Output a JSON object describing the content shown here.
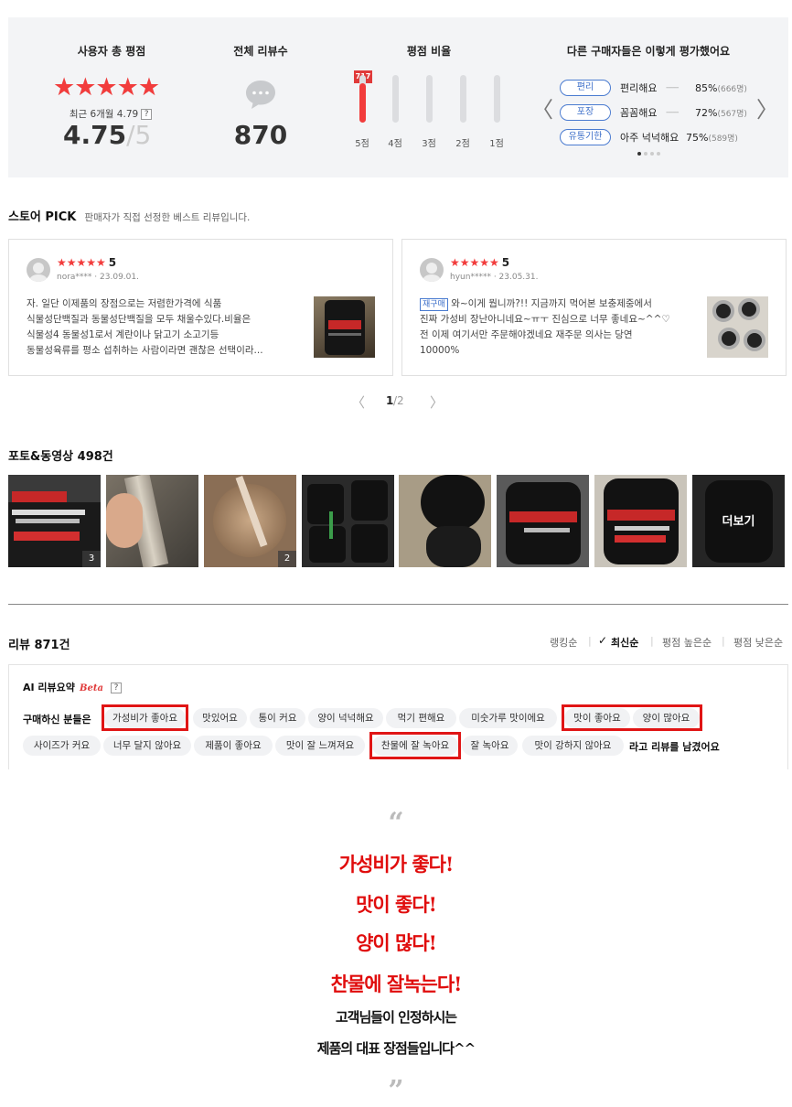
{
  "summary": {
    "rating_title": "사용자 총 평점",
    "recent_label": "최근 6개월 4.79",
    "help": "?",
    "rating": "4.75",
    "rating_max": "/5",
    "stars_value": 4.75,
    "total_title": "전체 리뷰수",
    "total_count": "870",
    "dist_title": "평점 비율",
    "dist": [
      {
        "label": "5점",
        "fraction": 0.82,
        "badge": "717"
      },
      {
        "label": "4점",
        "fraction": 0
      },
      {
        "label": "3점",
        "fraction": 0
      },
      {
        "label": "2점",
        "fraction": 0
      },
      {
        "label": "1점",
        "fraction": 0
      }
    ],
    "others_title": "다른 구매자들은 이렇게 평가했어요",
    "evaluations": [
      {
        "tag": "편리",
        "text": "편리해요",
        "dash": "------",
        "pct": "85%",
        "count": "(666명)"
      },
      {
        "tag": "포장",
        "text": "꼼꼼해요",
        "dash": "------",
        "pct": "72%",
        "count": "(567명)"
      },
      {
        "tag": "유통기한",
        "text": "아주 넉넉해요",
        "dash": "",
        "pct": "75%",
        "count": "(589명)"
      }
    ],
    "prev_arrow": "〈",
    "next_arrow": "〉"
  },
  "store_pick": {
    "title": "스토어 PICK",
    "subtitle": "판매자가 직접 선정한 베스트 리뷰입니다.",
    "cards": [
      {
        "stars": "★★★★★",
        "score": "5",
        "user": "nora****",
        "date": "23.09.01.",
        "lines": [
          "자. 일단 이제품의 장점으로는 저렴한가격에 식품",
          "식물성단백질과 동물성단백질을 모두 채울수있다.비율은",
          "식물성4 동물성1로서 계란이나 닭고기 소고기등",
          "동물성육류를 평소 섭취하는 사람이라면 괜찮은 선택이라..."
        ]
      },
      {
        "stars": "★★★★★",
        "score": "5",
        "user": "hyun*****",
        "date": "23.05.31.",
        "badge": "재구매",
        "lines": [
          "와~이게 뭡니까?!! 지금까지 먹어본 보충제중에서",
          "진짜 가성비 장난아니네요~ㅠㅜ 진심으로 너무 좋네요~^^♡",
          "전 이제 여기서만 주문해야겠네요 재주문 의사는 당연",
          "10000%"
        ]
      }
    ],
    "pager": {
      "current": "1",
      "total": "/2",
      "prev": "〈",
      "next": "〉"
    }
  },
  "photos": {
    "title": "포토&동영상",
    "count": "498건",
    "badges": [
      "3",
      "",
      "2",
      "",
      "",
      "",
      "",
      ""
    ],
    "more": "더보기"
  },
  "reviews": {
    "title": "리뷰 871건",
    "sort": [
      "랭킹순",
      "최신순",
      "평점 높은순",
      "평점 낮은순"
    ],
    "sort_active": "최신순",
    "check": "✓",
    "ai_title": "AI 리뷰요약",
    "ai_beta": "Beta",
    "lead": "구매하신 분들은",
    "chips_row1": [
      "가성비가 좋아요",
      "맛있어요",
      "통이 커요",
      "양이 넉넉해요",
      "먹기 편해요",
      "미숫가루 맛이에요",
      "맛이 좋아요",
      "양이 많아요"
    ],
    "chips_row2": [
      "사이즈가 커요",
      "너무 달지 않아요",
      "제품이 좋아요",
      "맛이 잘 느껴져요",
      "찬물에 잘 녹아요",
      "잘 녹아요",
      "맛이 강하지 않아요"
    ],
    "tail": "라고 리뷰를 남겼어요"
  },
  "promo": {
    "open_quote": "“",
    "close_quote": "”",
    "red_lines": [
      "가성비가 좋다!",
      "맛이 좋다!",
      "양이 많다!",
      "찬물에 잘녹는다!"
    ],
    "black_lines": [
      "고객님들이 인정하시는",
      "제품의 대표 장점들입니다^^"
    ]
  },
  "colors": {
    "accent_red": "#f23c3c",
    "highlight_box": "#e01515",
    "tag_blue": "#3d6fc9",
    "panel_bg": "#f3f4f6"
  }
}
